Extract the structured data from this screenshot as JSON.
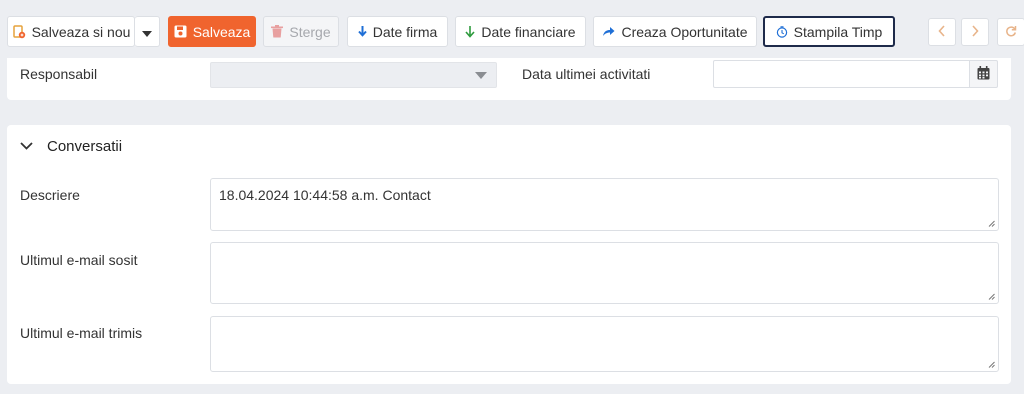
{
  "toolbar": {
    "save_new_label": "Salveaza si nou",
    "save_label": "Salveaza",
    "delete_label": "Sterge",
    "company_data_label": "Date firma",
    "financial_data_label": "Date financiare",
    "create_opportunity_label": "Creaza Oportunitate",
    "timestamp_label": "Stampila Timp"
  },
  "fields": {
    "responsible_label": "Responsabil",
    "responsible_value": "",
    "last_activity_label": "Data ultimei activitati",
    "last_activity_value": ""
  },
  "conversations": {
    "title": "Conversatii",
    "description_label": "Descriere",
    "description_value": "18.04.2024 10:44:58 a.m. Contact",
    "last_email_received_label": "Ultimul e-mail sosit",
    "last_email_received_value": "",
    "last_email_sent_label": "Ultimul e-mail trimis",
    "last_email_sent_value": ""
  },
  "colors": {
    "primary": "#f0642e",
    "accent_blue": "#1f6fd6",
    "accent_green": "#2e9b3e",
    "focus_border": "#1e2a4a",
    "background": "#eceef2"
  },
  "icons": {
    "save_new": "save-new-icon",
    "save": "floppy-disk-icon",
    "delete": "trash-icon",
    "company_data": "arrow-down-icon",
    "financial_data": "arrow-down-icon",
    "create_opportunity": "share-arrow-icon",
    "timestamp": "clock-icon",
    "prev": "chevron-left-icon",
    "next": "chevron-right-icon",
    "refresh": "refresh-icon",
    "calendar": "calendar-icon",
    "section_toggle": "chevron-down-icon"
  }
}
